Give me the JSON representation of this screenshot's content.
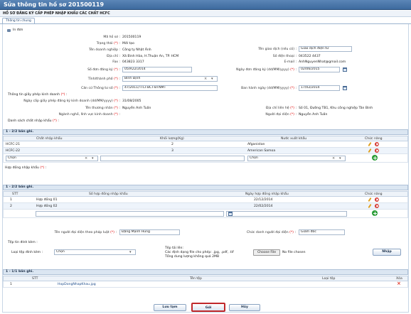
{
  "window": {
    "title": "Sửa thông tin hồ sơ 201500119"
  },
  "header": {
    "subtitle": "HỒ SƠ ĐĂNG KÝ CẤP PHÉP NHẬP KHẨU CÁC CHẤT HCFC"
  },
  "tabs": [
    {
      "label": "Thông tin chung"
    }
  ],
  "print": {
    "label": "In đơn"
  },
  "form": {
    "ma_ho_so": {
      "label": "Mã hồ sơ :",
      "value": "201500119"
    },
    "trang_thai": {
      "label": "Trạng thái",
      "req": "(*)",
      "value": "Mới tạo"
    },
    "ten_dn": {
      "label": "Tên doanh nghiệp :",
      "value": "Công ty Nhật Ánh"
    },
    "ten_giao_dich": {
      "label": "Tên giao dịch (nếu có) :",
      "value": "Giao dịch điện tử"
    },
    "dia_chi": {
      "label": "Địa chỉ :",
      "value": "Xã Bình Hòa, H.Thuận An, TP. HCM"
    },
    "so_dt": {
      "label": "Số điện thoại :",
      "value": "043522 4437"
    },
    "fax": {
      "label": "Fax :",
      "value": "043823 3317"
    },
    "email": {
      "label": "E-mail :",
      "value": "AnhNguyenNhat@gmail.com"
    },
    "so_don": {
      "label": "Số đơn đăng ký",
      "req": "(*)",
      "value": "05/R22/2014"
    },
    "ngay_don": {
      "label": "Ngày đơn đăng ký (dd/MM/yyyy)",
      "req": "(*)",
      "value": "02/06/2015"
    },
    "tinh": {
      "label": "Tỉnh/thành phố",
      "req": "(*)",
      "value": "Bình Định"
    },
    "can_cu": {
      "label": "Căn cứ Thông tư số",
      "req": "(*)",
      "value": "47/2011/TTLT-BCT-BTNMT"
    },
    "ban_hanh": {
      "label": "Ban hành ngày (dd/MM/yyyy)",
      "req": "(*)",
      "value": "17/02/2014"
    },
    "gp_kinh_doanh": {
      "label": "Thông tin giấy phép kinh doanh",
      "req": "(*)"
    },
    "ngay_cap_gp": {
      "label": "Ngày cấp giấy phép đăng ký kinh doanh (dd/MM/yyyy)",
      "req": "(*)",
      "value": "31/08/2005"
    },
    "nguoi_dai_dien": {
      "label": "Tên thương nhân",
      "req": "(*)",
      "value": "Nguyễn Anh Tuấn"
    },
    "dia_chi_lh": {
      "label": "Địa chỉ liên hệ",
      "req": "(*)",
      "value": "Số 01, Đường TB1, Khu công nghiệp Tân Bình"
    },
    "nganh_nghe": {
      "label": "Ngành nghề, lĩnh vực kinh doanh",
      "req": "(*)"
    },
    "nguoi_dd": {
      "label": "Người đại diện",
      "req": "(*)",
      "value": "Nguyễn Anh Tuấn"
    },
    "danh_sach": {
      "label": "Danh sách chất nhập khẩu",
      "req": "(*)"
    }
  },
  "table1": {
    "bar": "1 - 2/2 bản ghi.",
    "headers": [
      "Chất nhập khẩu",
      "Khối lượng(Kg)",
      "Nước xuất khẩu",
      "Chức năng"
    ],
    "rows": [
      {
        "chat": "HCFC-21",
        "kl": "2",
        "nuoc": "Afganistan"
      },
      {
        "chat": "HCFC-22",
        "kl": "3",
        "nuoc": "American Samoa"
      }
    ],
    "new_row": {
      "chat": "Chọn",
      "nuoc": "Chọn"
    }
  },
  "hop_dong_label": {
    "text": "Hợp đồng nhập khẩu",
    "req": "(*)"
  },
  "table2": {
    "bar": "1 - 2/2 bản ghi.",
    "headers": [
      "STT",
      "Số hợp đồng nhập khẩu",
      "Ngày hợp đồng nhập khẩu",
      "Chức năng"
    ],
    "rows": [
      {
        "stt": "1",
        "so": "Hợp đồng 01",
        "ngay": "22/12/2014"
      },
      {
        "stt": "2",
        "so": "Hợp đồng 02",
        "ngay": "22/02/2014"
      }
    ]
  },
  "ky": {
    "ten_nguoi": {
      "label": "Tên người đại diện theo pháp luật",
      "req": "(*)",
      "value": "Đặng Mạnh Hùng"
    },
    "chuc_danh": {
      "label": "Chức danh người đại diện",
      "req": "(*)",
      "value": "Giám đốc"
    }
  },
  "attach": {
    "label": "Tệp tin đính kèm :",
    "loai_label": "Loại tệp đính kèm :",
    "loai_value": "Chọn",
    "hint1": "Tệp tải lên:",
    "hint2": "Các định dạng file cho phép: .jpg, .pdf, .tif",
    "hint3": "Tổng dung lượng không quá 2MB",
    "choose": "Choose File",
    "nofile": "No file chosen",
    "import": "Nhập"
  },
  "table3": {
    "bar": "1 - 1/1 bản ghi.",
    "headers": [
      "STT",
      "Tên tệp",
      "Loại tệp",
      "Xóa"
    ],
    "rows": [
      {
        "stt": "1",
        "ten": "HopDongNhapKhau.jpg",
        "loai": ""
      }
    ]
  },
  "buttons": {
    "save": "Lưu tạm",
    "send": "Gửi",
    "cancel": "Hủy"
  }
}
